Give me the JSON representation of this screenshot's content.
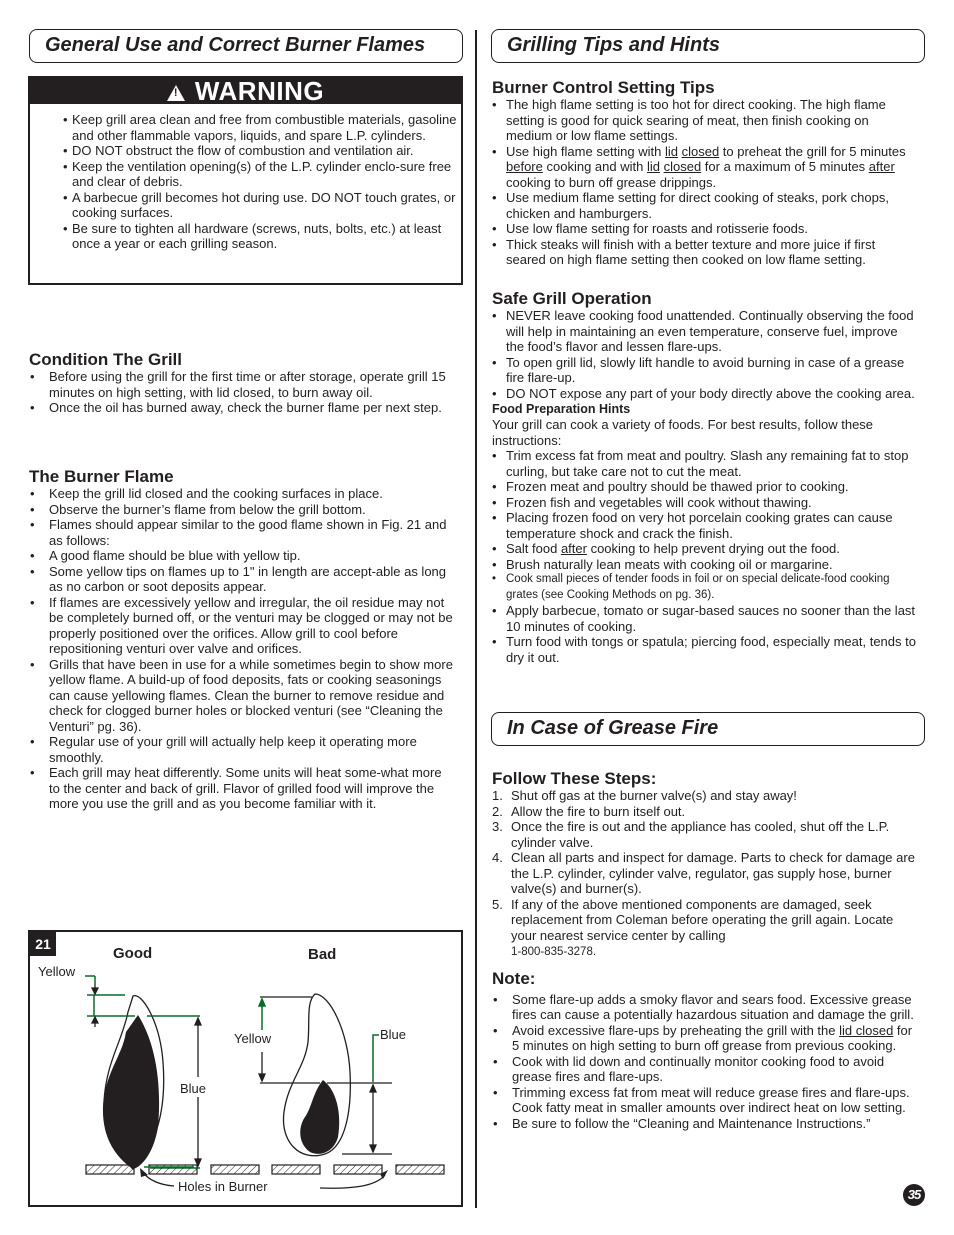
{
  "left": {
    "section_title": "General Use and Correct Burner Flames",
    "warning": {
      "label": "WARNING",
      "icon": "warning-triangle-icon",
      "items": [
        "Keep grill area clean and free from combustible materials, gasoline and other flammable vapors, liquids, and spare L.P. cylinders.",
        "DO NOT obstruct the flow of combustion and ventilation air.",
        "Keep the ventilation opening(s) of the L.P. cylinder enclo-sure free and clear of debris.",
        "A barbecue grill becomes hot during use. DO NOT touch grates, or cooking surfaces.",
        "Be sure to tighten all hardware (screws, nuts, bolts, etc.) at least once a year or each grilling season."
      ]
    },
    "condition": {
      "heading": "Condition The Grill",
      "items": [
        "Before using the grill for the first time or after storage, operate grill 15 minutes on high setting, with lid closed, to burn away oil.",
        "Once the oil has burned away, check the burner flame per next step."
      ]
    },
    "burner_flame": {
      "heading": "The Burner Flame",
      "items": [
        "Keep the grill lid closed and the cooking surfaces in place.",
        "Observe the burner’s flame from below the grill bottom.",
        "Flames should appear similar to the good flame shown in Fig. 21 and as follows:",
        "A good flame should be blue with yellow tip.",
        "Some yellow tips on flames up to 1\" in length are accept-able as long as no carbon or soot deposits appear.",
        "If flames are excessively yellow and irregular, the oil residue may not be completely burned off, or the venturi may be clogged or may not be properly positioned over the orifices. Allow grill to cool before repositioning venturi over valve and orifices.",
        "Grills that have been in use for a while sometimes begin to show more yellow flame. A build-up of food deposits, fats or cooking seasonings can cause yellowing flames. Clean the burner to remove residue and check for clogged burner holes or blocked venturi (see “Cleaning the Venturi” pg. 36).",
        "Regular use of your grill will actually help keep it operating more smoothly.",
        "Each grill may heat differently. Some units will heat some-what more to the center and back of grill. Flavor of grilled food will improve the more you use the grill and as you become familiar with it."
      ]
    },
    "figure": {
      "number": "21",
      "good_label": "Good",
      "bad_label": "Bad",
      "yellow_label": "Yellow",
      "blue_label": "Blue",
      "holes_label": "Holes in Burner",
      "accent_color": "#0a6b2a"
    }
  },
  "right": {
    "section_title": "Grilling Tips and Hints",
    "burner_control": {
      "heading": "Burner Control Setting Tips",
      "items": [
        {
          "parts": [
            {
              "t": "The high flame setting is too hot for direct cooking. The high flame setting is good for quick searing of meat, then finish cooking on medium or low flame settings."
            }
          ]
        },
        {
          "parts": [
            {
              "t": "Use high flame setting with "
            },
            {
              "t": "lid",
              "u": true
            },
            {
              "t": " "
            },
            {
              "t": "closed",
              "u": true
            },
            {
              "t": " to preheat the grill for 5 minutes "
            },
            {
              "t": "before",
              "u": true
            },
            {
              "t": " cooking and with "
            },
            {
              "t": "lid",
              "u": true
            },
            {
              "t": " "
            },
            {
              "t": "closed",
              "u": true
            },
            {
              "t": " for a maximum of 5 minutes "
            },
            {
              "t": "after",
              "u": true
            },
            {
              "t": " cooking to burn off grease drippings."
            }
          ]
        },
        {
          "parts": [
            {
              "t": "Use medium flame setting for direct cooking of steaks, pork chops, chicken and hamburgers."
            }
          ]
        },
        {
          "parts": [
            {
              "t": "Use low flame setting for roasts and rotisserie foods."
            }
          ]
        },
        {
          "parts": [
            {
              "t": "Thick steaks will finish with a better texture and more juice if first seared on high flame setting then cooked on low flame setting."
            }
          ]
        }
      ]
    },
    "safe_operation": {
      "heading": "Safe Grill Operation",
      "items": [
        "NEVER leave cooking food unattended. Continually observing the food will help in maintaining an even temperature, conserve fuel, improve the food’s flavor and lessen flare-ups.",
        "To open grill lid, slowly lift handle to avoid burning in case of a grease fire flare-up.",
        "DO NOT expose any part of your body directly above the cooking area."
      ]
    },
    "food_prep": {
      "heading": "Food Preparation Hints",
      "intro": "Your grill can cook a variety of foods. For best results, follow these instructions:",
      "items": [
        {
          "parts": [
            {
              "t": "Trim excess fat from meat and poultry. Slash any remaining fat to stop curling, but take care not to cut the meat."
            }
          ]
        },
        {
          "parts": [
            {
              "t": "Frozen meat and poultry should be thawed prior to cooking."
            }
          ]
        },
        {
          "parts": [
            {
              "t": "Frozen fish and vegetables will cook without thawing."
            }
          ]
        },
        {
          "parts": [
            {
              "t": "Placing frozen food on very hot porcelain cooking grates can cause temperature shock and crack the finish."
            }
          ]
        },
        {
          "parts": [
            {
              "t": "Salt food "
            },
            {
              "t": "after",
              "u": true
            },
            {
              "t": " cooking to help prevent drying out the food."
            }
          ]
        },
        {
          "parts": [
            {
              "t": "Brush naturally lean meats with cooking oil or margarine."
            }
          ]
        },
        {
          "parts": [
            {
              "t": "Cook small pieces of tender foods in foil or on special delicate-food cooking grates (see Cooking Methods on pg. 36)."
            }
          ],
          "small": true
        },
        {
          "parts": [
            {
              "t": "Apply barbecue, tomato or sugar-based sauces no sooner than the last 10 minutes of cooking."
            }
          ]
        },
        {
          "parts": [
            {
              "t": "Turn food with tongs or spatula; piercing food, especially meat, tends to dry it out."
            }
          ]
        }
      ]
    },
    "grease_fire": {
      "section_title": "In Case of Grease Fire",
      "steps_heading": "Follow These Steps:",
      "steps": [
        {
          "n": "1.",
          "t": "Shut off gas at the burner valve(s) and stay away!"
        },
        {
          "n": "2.",
          "t": "Allow the fire to burn itself out."
        },
        {
          "n": "3.",
          "t": "Once the fire is out and the appliance has cooled, shut off the L.P. cylinder valve."
        },
        {
          "n": "4.",
          "t": "Clean all parts and inspect for damage. Parts to check for damage are the L.P. cylinder, cylinder valve, regulator, gas supply hose, burner valve(s) and burner(s)."
        },
        {
          "n": "5.",
          "t": "If any of the above mentioned components are damaged, seek replacement from Coleman before operating the grill again. Locate your nearest service center by calling",
          "phone": "1-800-835-3278."
        }
      ],
      "note_heading": "Note:",
      "notes": [
        {
          "parts": [
            {
              "t": "Some flare-up adds a smoky flavor and sears food. Excessive grease fires can cause a potentially hazardous situation and damage the grill."
            }
          ]
        },
        {
          "parts": [
            {
              "t": "Avoid excessive flare-ups by preheating the grill with the "
            },
            {
              "t": "lid closed",
              "u": true
            },
            {
              "t": " for 5 minutes on high setting to burn off grease from previous cooking."
            }
          ]
        },
        {
          "parts": [
            {
              "t": "Cook with lid down and continually monitor cooking food to avoid grease fires and flare-ups."
            }
          ]
        },
        {
          "parts": [
            {
              "t": "Trimming excess fat from meat will reduce grease fires and flare-ups. Cook fatty meat in smaller amounts over indirect heat on low setting."
            }
          ]
        },
        {
          "parts": [
            {
              "t": "Be sure to follow the “Cleaning and Maintenance Instructions.”"
            }
          ]
        }
      ]
    }
  },
  "page_number": "35"
}
